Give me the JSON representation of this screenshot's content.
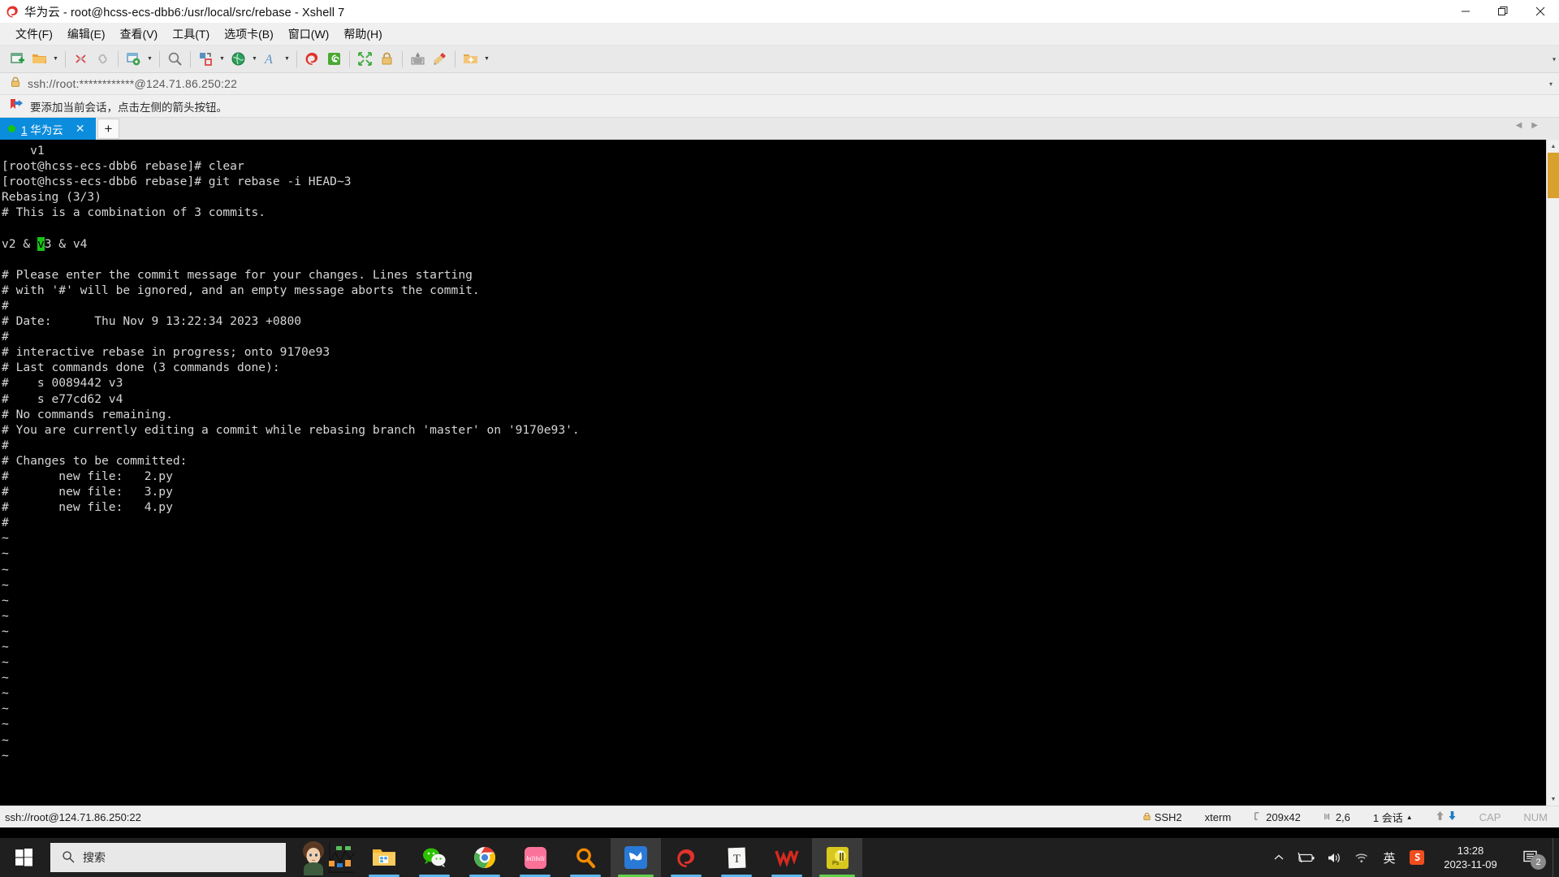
{
  "window": {
    "title": "华为云 - root@hcss-ecs-dbb6:/usr/local/src/rebase - Xshell 7",
    "app_icon": "xshell-logo-icon",
    "minimize_label": "—",
    "maximize_label": "❐",
    "close_label": "✕"
  },
  "menu": {
    "items": [
      {
        "label": "文件(F)",
        "name": "menu-file"
      },
      {
        "label": "编辑(E)",
        "name": "menu-edit"
      },
      {
        "label": "查看(V)",
        "name": "menu-view"
      },
      {
        "label": "工具(T)",
        "name": "menu-tools"
      },
      {
        "label": "选项卡(B)",
        "name": "menu-tabs"
      },
      {
        "label": "窗口(W)",
        "name": "menu-window"
      },
      {
        "label": "帮助(H)",
        "name": "menu-help"
      }
    ]
  },
  "toolbar": {
    "buttons": [
      "new-session-icon",
      "open-folder-icon",
      "dropdown-caret",
      "separator",
      "disconnect-icon",
      "link-icon",
      "separator",
      "session-properties-icon",
      "dropdown-caret",
      "separator",
      "find-icon",
      "separator",
      "transfer-file-icon",
      "dropdown-caret",
      "globe-icon",
      "dropdown-caret",
      "font-icon",
      "dropdown-caret",
      "separator",
      "xshell-icon",
      "xftp-icon",
      "separator",
      "fullscreen-icon",
      "lock-icon",
      "separator",
      "keyboard-icon",
      "highlight-icon",
      "separator",
      "add-note-icon",
      "dropdown-caret"
    ],
    "overflow_caret": "▾"
  },
  "address_bar": {
    "lock_icon": "lock-icon",
    "value": "ssh://root:************@124.71.86.250:22",
    "caret": "▾"
  },
  "notice": {
    "icon": "bookmark-arrow-icon",
    "text": "要添加当前会话，点击左侧的箭头按钮。"
  },
  "tabs": {
    "items": [
      {
        "index": "1",
        "label": "华为云",
        "status": "connected",
        "close_label": "✕"
      }
    ],
    "add_label": "+",
    "scroll_left": "◀",
    "scroll_right": "▶"
  },
  "terminal": {
    "lines": [
      "    v1",
      "[root@hcss-ecs-dbb6 rebase]# clear",
      "[root@hcss-ecs-dbb6 rebase]# git rebase -i HEAD~3",
      "Rebasing (3/3)",
      "# This is a combination of 3 commits.",
      "",
      "CURSOR_LINE",
      "",
      "# Please enter the commit message for your changes. Lines starting",
      "# with '#' will be ignored, and an empty message aborts the commit.",
      "#",
      "# Date:      Thu Nov 9 13:22:34 2023 +0800",
      "#",
      "# interactive rebase in progress; onto 9170e93",
      "# Last commands done (3 commands done):",
      "#    s 0089442 v3",
      "#    s e77cd62 v4",
      "# No commands remaining.",
      "# You are currently editing a commit while rebasing branch 'master' on '9170e93'.",
      "#",
      "# Changes to be committed:",
      "#       new file:   2.py",
      "#       new file:   3.py",
      "#       new file:   4.py",
      "#",
      "~",
      "~",
      "~",
      "~",
      "~",
      "~",
      "~",
      "~",
      "~",
      "~",
      "~",
      "~",
      "~",
      "~",
      "~"
    ],
    "cursor_line": {
      "before": "v2 & ",
      "cursor_char": "v",
      "after": "3 & v4"
    },
    "cursor_color": "#19c319",
    "foreground": "#d6d6d6",
    "background": "#000000"
  },
  "statusbar": {
    "connection": "ssh://root@124.71.86.250:22",
    "protocol": "SSH2",
    "terminal_type": "xterm",
    "size_icon": "resize-icon",
    "size": "209x42",
    "position_icon": "cursor-position-icon",
    "position": "2,6",
    "sessions": "1 会话",
    "sessions_caret": "▲",
    "upload_icon": "upload-arrow-icon",
    "download_icon": "download-arrow-icon",
    "cap": "CAP",
    "num": "NUM",
    "lock_icon": "lock-icon"
  },
  "taskbar": {
    "start_icon": "windows-start-icon",
    "search_icon": "search-icon",
    "search_placeholder": "搜索",
    "apps": [
      {
        "name": "taskbar-app-cortana-avatar",
        "icon": "avatar-icon",
        "active": false
      },
      {
        "name": "taskbar-app-file-explorer",
        "icon": "folder-icon",
        "active": false
      },
      {
        "name": "taskbar-app-wechat",
        "icon": "wechat-icon",
        "active": false
      },
      {
        "name": "taskbar-app-chrome",
        "icon": "chrome-icon",
        "active": false
      },
      {
        "name": "taskbar-app-bilibili",
        "icon": "bilibili-icon",
        "active": false
      },
      {
        "name": "taskbar-app-everything",
        "icon": "magnifier-orange-icon",
        "active": false
      },
      {
        "name": "taskbar-app-foxmail",
        "icon": "foxmail-bird-icon",
        "active": true
      },
      {
        "name": "taskbar-app-xshell",
        "icon": "xshell-icon",
        "active": false
      },
      {
        "name": "taskbar-app-typora",
        "icon": "typora-icon",
        "active": false
      },
      {
        "name": "taskbar-app-wps",
        "icon": "wps-icon",
        "active": false
      },
      {
        "name": "taskbar-app-photoshop",
        "icon": "photoshop-icon",
        "active": true
      }
    ],
    "tray": {
      "expand_icon": "chevron-up-icon",
      "battery_icon": "battery-icon",
      "volume_icon": "speaker-icon",
      "network_icon": "wifi-icon",
      "ime_label": "英",
      "sogou_icon": "sogou-icon",
      "time": "13:28",
      "date": "2023-11-09",
      "notification_icon": "action-center-icon",
      "notification_count": "2"
    }
  },
  "colors": {
    "accent_blue": "#0b8cdc",
    "taskbar_bg": "#1f1f1f",
    "terminal_bg": "#000000",
    "chrome_bg": "#f0f0f0",
    "scrollbar_thumb": "#d8a02c"
  }
}
